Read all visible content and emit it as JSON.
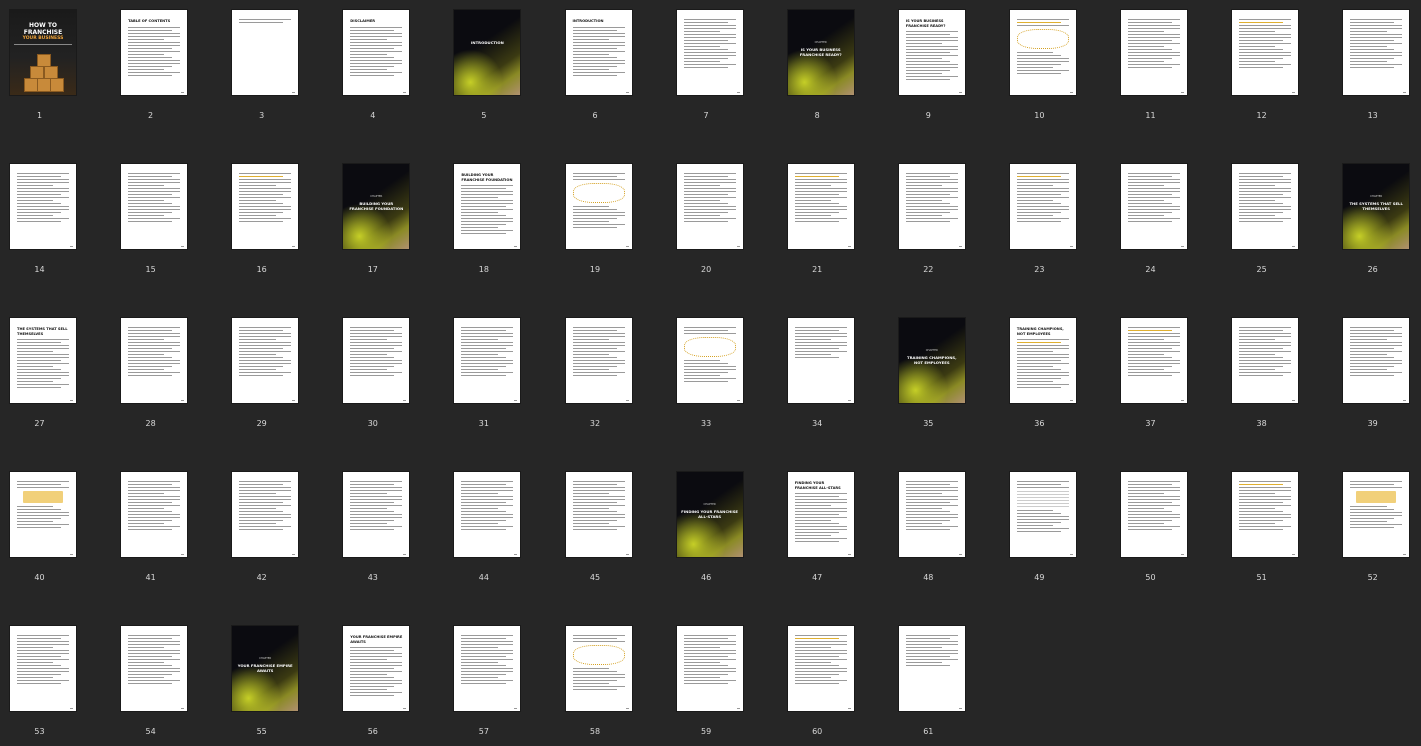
{
  "window": {
    "title": ""
  },
  "cover": {
    "line1": "HOW TO",
    "line2": "FRANCHISE",
    "line3": "YOUR BUSINESS"
  },
  "chapters": {
    "5": "INTRODUCTION",
    "8": "IS YOUR BUSINESS FRANCHISE READY?",
    "17": "BUILDING YOUR FRANCHISE FOUNDATION",
    "26": "THE SYSTEMS THAT SELL THEMSELVES",
    "35": "TRAINING CHAMPIONS, NOT EMPLOYEES",
    "46": "FINDING YOUR FRANCHISE ALL-STARS",
    "55": "YOUR FRANCHISE EMPIRE AWAITS"
  },
  "chapter_label": "CHAPTER",
  "titled_pages": {
    "2": "TABLE OF CONTENTS",
    "4": "DISCLAIMER",
    "6": "INTRODUCTION",
    "9": "IS YOUR BUSINESS FRANCHISE READY?",
    "18": "BUILDING YOUR FRANCHISE FOUNDATION",
    "27": "THE SYSTEMS THAT SELL THEMSELVES",
    "36": "TRAINING CHAMPIONS, NOT EMPLOYEES",
    "47": "FINDING YOUR FRANCHISE ALL-STARS",
    "56": "YOUR FRANCHISE EMPIRE AWAITS"
  },
  "pages": [
    "1",
    "2",
    "3",
    "4",
    "5",
    "6",
    "7",
    "8",
    "9",
    "10",
    "11",
    "12",
    "13",
    "14",
    "15",
    "16",
    "17",
    "18",
    "19",
    "20",
    "21",
    "22",
    "23",
    "24",
    "25",
    "26",
    "27",
    "28",
    "29",
    "30",
    "31",
    "32",
    "33",
    "34",
    "35",
    "36",
    "37",
    "38",
    "39",
    "40",
    "41",
    "42",
    "43",
    "44",
    "45",
    "46",
    "47",
    "48",
    "49",
    "50",
    "51",
    "52",
    "53",
    "54",
    "55",
    "56",
    "57",
    "58",
    "59",
    "60",
    "61"
  ]
}
